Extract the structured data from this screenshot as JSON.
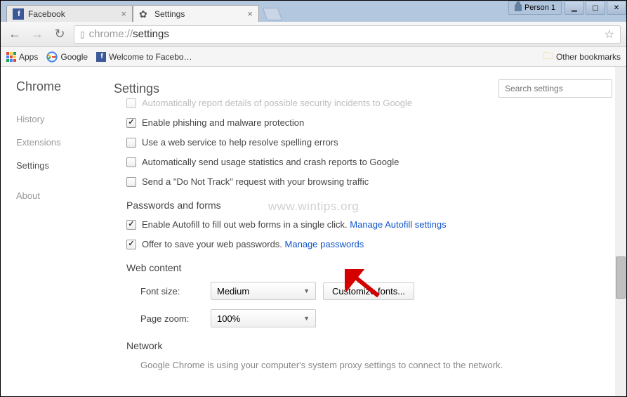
{
  "window": {
    "profile": "Person 1",
    "min": "▁",
    "max": "▢",
    "close": "✕"
  },
  "tabs": [
    {
      "title": "Facebook"
    },
    {
      "title": "Settings"
    }
  ],
  "omnibox": {
    "scheme": "chrome://",
    "path": "settings"
  },
  "bookmarks": {
    "apps": "Apps",
    "google": "Google",
    "welcome": "Welcome to Facebo…",
    "other": "Other bookmarks"
  },
  "sidebar": {
    "title": "Chrome",
    "items": [
      "History",
      "Extensions",
      "Settings",
      "About"
    ]
  },
  "content": {
    "title": "Settings",
    "search_placeholder": "Search settings",
    "privacy_partial": "Automatically report details of possible security incidents to Google",
    "privacy_items": [
      {
        "label": "Enable phishing and malware protection",
        "checked": true
      },
      {
        "label": "Use a web service to help resolve spelling errors",
        "checked": false
      },
      {
        "label": "Automatically send usage statistics and crash reports to Google",
        "checked": false
      },
      {
        "label": "Send a \"Do Not Track\" request with your browsing traffic",
        "checked": false
      }
    ],
    "passwords_section": "Passwords and forms",
    "pw_autofill": {
      "label": "Enable Autofill to fill out web forms in a single click. ",
      "link": "Manage Autofill settings"
    },
    "pw_save": {
      "label": "Offer to save your web passwords. ",
      "link": "Manage passwords"
    },
    "web_section": "Web content",
    "font_label": "Font size:",
    "font_value": "Medium",
    "font_btn": "Customize fonts...",
    "zoom_label": "Page zoom:",
    "zoom_value": "100%",
    "network_section": "Network",
    "network_text": "Google Chrome is using your computer's system proxy settings to connect to the network."
  },
  "watermark": "www.wintips.org"
}
